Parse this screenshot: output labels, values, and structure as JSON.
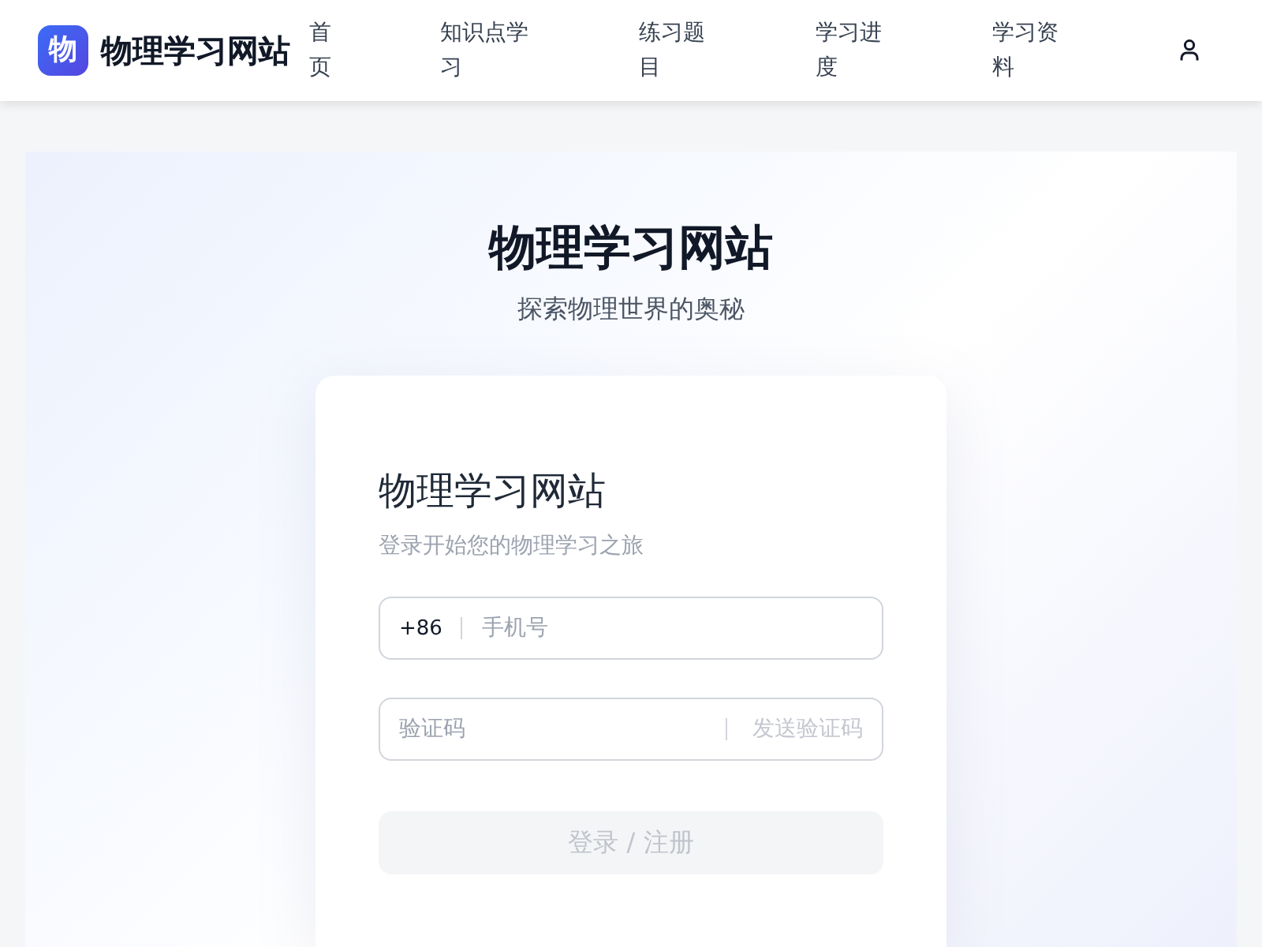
{
  "header": {
    "logo_mark": "物",
    "site_name": "物理学习网站",
    "nav": [
      {
        "label": "首页"
      },
      {
        "label": "知识点学习"
      },
      {
        "label": "练习题目"
      },
      {
        "label": "学习进度"
      },
      {
        "label": "学习资料"
      }
    ]
  },
  "hero": {
    "title": "物理学习网站",
    "subtitle": "探索物理世界的奥秘"
  },
  "login_card": {
    "title": "物理学习网站",
    "subtitle": "登录开始您的物理学习之旅",
    "phone_field": {
      "prefix": "+86",
      "placeholder": "手机号"
    },
    "code_field": {
      "placeholder": "验证码",
      "send_button": {
        "label": "发送验证码",
        "disabled": true
      }
    },
    "submit_button": {
      "label": "登录 / 注册",
      "disabled": true
    }
  }
}
